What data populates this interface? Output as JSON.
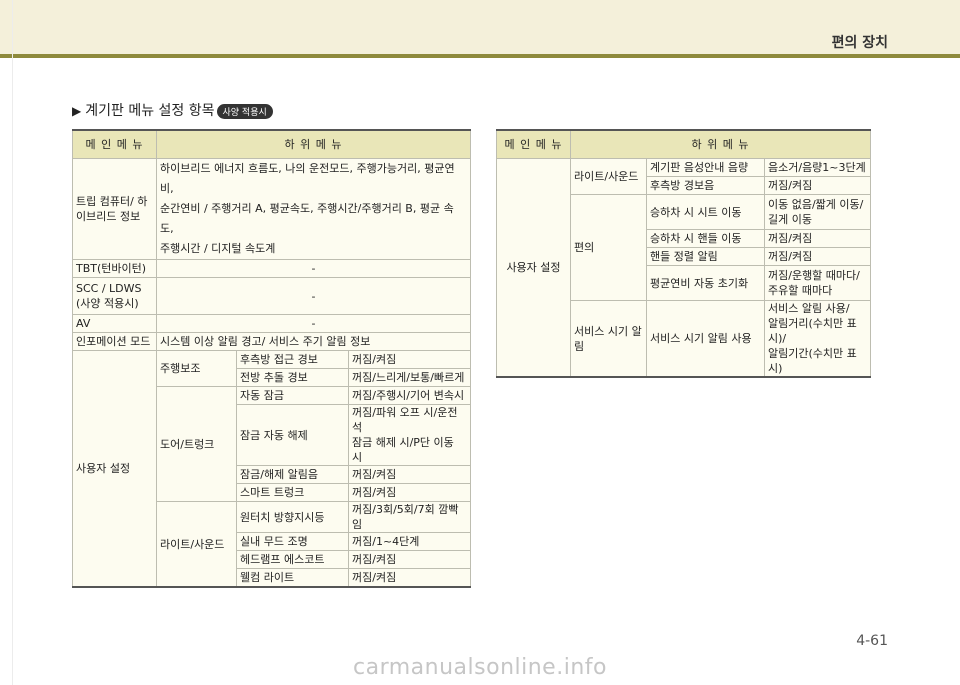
{
  "header": {
    "title": "편의 장치"
  },
  "section": {
    "title": "계기판 메뉴 설정 항목",
    "badge": "사양 적용시"
  },
  "table1": {
    "col_main": "메 인 메 뉴",
    "col_sub": "하 위 메 뉴",
    "trip": {
      "main": "트립 컴퓨터/ 하이브리드 정보",
      "lines": [
        "하이브리드 에너지 흐름도, 나의 운전모드, 주행가능거리, 평균연비,",
        "순간연비 / 주행거리 A, 평균속도, 주행시간/주행거리 B, 평균 속도,",
        "주행시간 / 디지털 속도계"
      ]
    },
    "tbt": {
      "main": "TBT(턴바이턴)",
      "sub": "-"
    },
    "scc": {
      "main_1": "SCC / LDWS",
      "main_2": "(사양 적용시)",
      "sub": "-"
    },
    "av": {
      "main": "AV",
      "sub": "-"
    },
    "info": {
      "main": "인포메이션 모드",
      "sub": "시스템 이상 알림 경고/ 서비스 주기 알림 정보"
    },
    "user": {
      "main": "사용자 설정",
      "driving": {
        "label": "주행보조",
        "rows": [
          {
            "item": "후측방 접근 경보",
            "value": "꺼짐/켜짐"
          },
          {
            "item": "전방 추돌 경보",
            "value": "꺼짐/느리게/보통/빠르게"
          }
        ]
      },
      "door": {
        "label": "도어/트렁크",
        "rows": [
          {
            "item": "자동 잠금",
            "value": "꺼짐/주행시/기어 변속시"
          },
          {
            "item": "잠금 자동 해제",
            "value_1": "꺼짐/파워 오프 시/운전석",
            "value_2": "잠금 해제 시/P단 이동 시"
          },
          {
            "item": "잠금/해제 알림음",
            "value": "꺼짐/켜짐"
          },
          {
            "item": "스마트 트렁크",
            "value": "꺼짐/켜짐"
          }
        ]
      },
      "light": {
        "label": "라이트/사운드",
        "rows": [
          {
            "item": "원터치 방향지시등",
            "value": "꺼짐/3회/5회/7회 깜빡임"
          },
          {
            "item": "실내 무드 조명",
            "value": "꺼짐/1~4단계"
          },
          {
            "item": "헤드램프 에스코트",
            "value": "꺼짐/켜짐"
          },
          {
            "item": "웰컴 라이트",
            "value": "꺼짐/켜짐"
          }
        ]
      }
    }
  },
  "table2": {
    "col_main": "메 인 메 뉴",
    "col_sub": "하 위 메 뉴",
    "main": "사용자 설정",
    "light": {
      "label": "라이트/사운드",
      "rows": [
        {
          "item": "계기판 음성안내 음량",
          "value": "음소거/음량1~3단계"
        },
        {
          "item": "후측방 경보음",
          "value": "꺼짐/켜짐"
        }
      ]
    },
    "convenience": {
      "label": "편의",
      "rows": [
        {
          "item": "승하차 시 시트 이동",
          "value_1": "이동 없음/짧게 이동/",
          "value_2": "길게 이동"
        },
        {
          "item": "승하차 시 핸들 이동",
          "value": "꺼짐/켜짐"
        },
        {
          "item": "핸들 정렬 알림",
          "value": "꺼짐/켜짐"
        },
        {
          "item": "평균연비 자동 초기화",
          "value_1": "꺼짐/운행할 때마다/",
          "value_2": "주유할 때마다"
        }
      ]
    },
    "service": {
      "label": "서비스 시기 알림",
      "item": "서비스 시기 알림 사용",
      "value_1": "서비스 알림 사용/",
      "value_2": "알림거리(수치만 표시)/",
      "value_3": "알림기간(수치만 표시)"
    }
  },
  "footer": {
    "page": "4-61",
    "watermark": "carmanualsonline.info"
  }
}
